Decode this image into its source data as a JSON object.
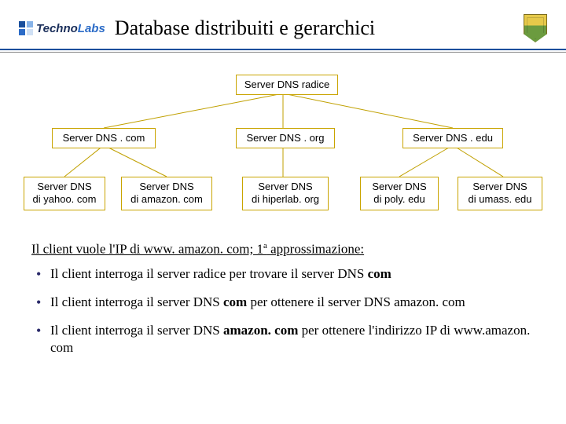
{
  "logo": {
    "word1": "Techno",
    "word2": "Labs"
  },
  "title": "Database distribuiti e gerarchici",
  "tree": {
    "root": "Server DNS radice",
    "tlds": {
      "com": "Server DNS . com",
      "org": "Server DNS . org",
      "edu": "Server DNS . edu"
    },
    "leaves": {
      "yahoo": "Server DNS\ndi yahoo. com",
      "amazon": "Server DNS\ndi amazon. com",
      "hiperlab": "Server DNS\ndi hiperlab. org",
      "poly": "Server DNS\ndi poly. edu",
      "umass": "Server DNS\ndi umass. edu"
    }
  },
  "lead": {
    "pre": "Il client vuole l'IP di www. amazon. com; 1",
    "sup": "a",
    "post": " approssimazione:"
  },
  "bullets": {
    "b1_pre": "Il client interroga il server radice per trovare il server DNS ",
    "b1_bold": "com",
    "b2_pre": "Il client interroga il server DNS ",
    "b2_bold": "com",
    "b2_post": " per ottenere il server DNS amazon. com",
    "b3_pre": "Il client interroga il server DNS ",
    "b3_bold": "amazon. com",
    "b3_post": " per ottenere l'indirizzo IP di www.amazon. com"
  }
}
